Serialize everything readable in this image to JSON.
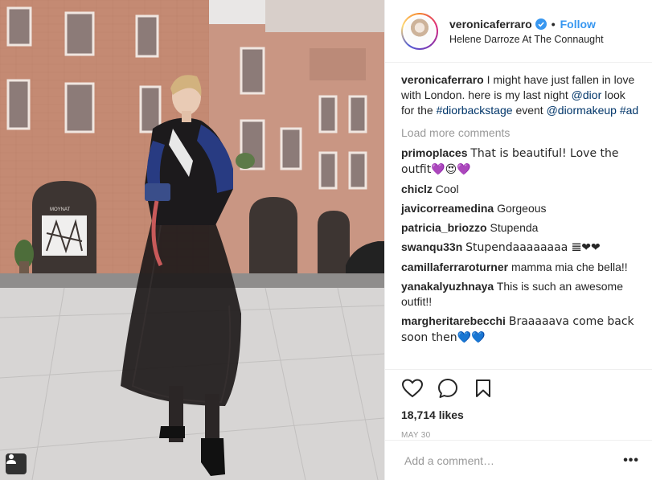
{
  "photo": {
    "alt_icon": "person-tag-icon",
    "shop_sign": "MOYNAT"
  },
  "header": {
    "username": "veronicaferraro",
    "verified_icon": "verified-badge-icon",
    "separator": "•",
    "follow_label": "Follow",
    "location": "Helene Darroze At The Connaught"
  },
  "caption": {
    "username": "veronicaferraro",
    "text1": "I might have just fallen in love with London. here is my last night",
    "mention1": "@dior",
    "text2": "look for the",
    "hashtag1": "#diorbackstage",
    "text3": "event",
    "mention2": "@diormakeup",
    "hashtag2": "#ad"
  },
  "load_more": "Load more comments",
  "comments": [
    {
      "user": "primoplaces",
      "text": "That is beautiful! Love the outfit💜😍💜"
    },
    {
      "user": "chiclz",
      "text": "Cool"
    },
    {
      "user": "javicorreamedina",
      "text": "Gorgeous"
    },
    {
      "user": "patricia_briozzo",
      "text": "Stupenda"
    },
    {
      "user": "swanqu33n",
      "text": "Stupendaaaaaaaa 𝌆❤❤"
    },
    {
      "user": "camillaferraroturner",
      "text": "mamma mia che bella!!"
    },
    {
      "user": "yanakalyuzhnaya",
      "text": "This is such an awesome outfit!!"
    },
    {
      "user": "margheritarebecchi",
      "text": "Braaaaava come back soon then💙💙"
    }
  ],
  "actions": {
    "like_icon": "heart-icon",
    "comment_icon": "comment-bubble-icon",
    "save_icon": "bookmark-icon",
    "likes": "18,714 likes",
    "date": "MAY 30"
  },
  "add_comment": {
    "placeholder": "Add a comment…",
    "more_label": "•••"
  },
  "colors": {
    "link": "#003569",
    "follow": "#3897f0",
    "muted": "#999999",
    "verified": "#3897f0"
  }
}
